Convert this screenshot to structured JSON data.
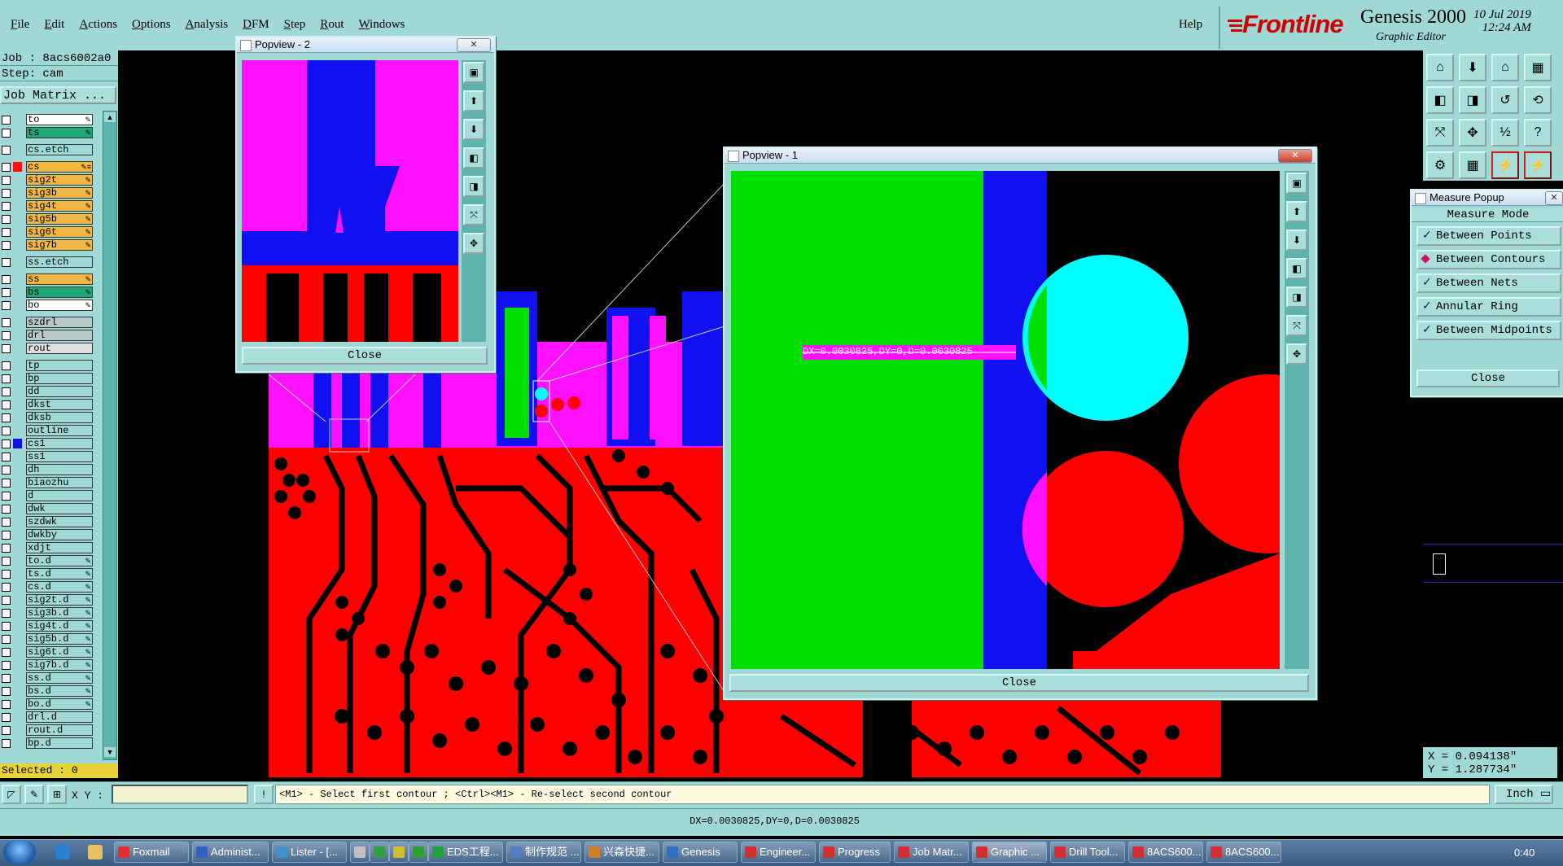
{
  "menu": {
    "items": [
      "File",
      "Edit",
      "Actions",
      "Options",
      "Analysis",
      "DFM",
      "Step",
      "Rout",
      "Windows"
    ],
    "help": "Help"
  },
  "brand": {
    "logo": "Frontline",
    "product": "Genesis 2000",
    "subtitle": "Graphic Editor",
    "date": "10 Jul 2019",
    "time": "12:24 AM"
  },
  "left_panel": {
    "job": "Job : 8acs6002a0",
    "step": "Step: cam",
    "job_matrix": "Job Matrix ...",
    "selected": "Selected : 0",
    "layers": [
      {
        "name": "to",
        "color": "#ffffff",
        "mark": "✎",
        "group": 1
      },
      {
        "name": "ts",
        "color": "#1fa876",
        "mark": "✎",
        "group": 1
      },
      {
        "name": "cs.etch",
        "color": "#9fd8d4",
        "mark": "",
        "group": 2
      },
      {
        "name": "cs",
        "color": "#f0b840",
        "mark": "✎≡",
        "group": 3,
        "swatch": "#ff1010"
      },
      {
        "name": "sig2t",
        "color": "#f0b840",
        "mark": "✎",
        "group": 3
      },
      {
        "name": "sig3b",
        "color": "#f0b840",
        "mark": "✎",
        "group": 3
      },
      {
        "name": "sig4t",
        "color": "#f0b840",
        "mark": "✎",
        "group": 3
      },
      {
        "name": "sig5b",
        "color": "#f0b840",
        "mark": "✎",
        "group": 3
      },
      {
        "name": "sig6t",
        "color": "#f0b840",
        "mark": "✎",
        "group": 3
      },
      {
        "name": "sig7b",
        "color": "#f0b840",
        "mark": "✎",
        "group": 3
      },
      {
        "name": "ss.etch",
        "color": "#9fd8d4",
        "mark": "",
        "group": 4
      },
      {
        "name": "ss",
        "color": "#f0b840",
        "mark": "✎",
        "group": 5
      },
      {
        "name": "bs",
        "color": "#1fa876",
        "mark": "✎",
        "group": 5
      },
      {
        "name": "bo",
        "color": "#ffffff",
        "mark": "✎",
        "group": 5
      },
      {
        "name": "szdrl",
        "color": "#b8c8c8",
        "mark": "",
        "group": 6
      },
      {
        "name": "drl",
        "color": "#b8c8c8",
        "mark": "",
        "group": 6
      },
      {
        "name": "rout",
        "color": "#e0e0e0",
        "mark": "",
        "group": 6
      },
      {
        "name": "tp",
        "color": "#9fd8d4",
        "mark": "",
        "group": 7
      },
      {
        "name": "bp",
        "color": "#9fd8d4",
        "mark": "",
        "group": 7
      },
      {
        "name": "dd",
        "color": "#9fd8d4",
        "mark": "",
        "group": 7
      },
      {
        "name": "dkst",
        "color": "#9fd8d4",
        "mark": "",
        "group": 7
      },
      {
        "name": "dksb",
        "color": "#9fd8d4",
        "mark": "",
        "group": 7
      },
      {
        "name": "outline",
        "color": "#9fd8d4",
        "mark": "",
        "group": 7
      },
      {
        "name": "cs1",
        "color": "#9fd8d4",
        "mark": "",
        "group": 7,
        "swatch": "#1010e0"
      },
      {
        "name": "ss1",
        "color": "#9fd8d4",
        "mark": "",
        "group": 7
      },
      {
        "name": "dh",
        "color": "#9fd8d4",
        "mark": "",
        "group": 7
      },
      {
        "name": "biaozhu",
        "color": "#9fd8d4",
        "mark": "",
        "group": 7
      },
      {
        "name": "d",
        "color": "#9fd8d4",
        "mark": "",
        "group": 7
      },
      {
        "name": "dwk",
        "color": "#9fd8d4",
        "mark": "",
        "group": 7
      },
      {
        "name": "szdwk",
        "color": "#9fd8d4",
        "mark": "",
        "group": 7
      },
      {
        "name": "dwkby",
        "color": "#9fd8d4",
        "mark": "",
        "group": 7
      },
      {
        "name": "xdjt",
        "color": "#9fd8d4",
        "mark": "",
        "group": 7
      },
      {
        "name": "to.d",
        "color": "#9fd8d4",
        "mark": "✎",
        "group": 7
      },
      {
        "name": "ts.d",
        "color": "#9fd8d4",
        "mark": "✎",
        "group": 7
      },
      {
        "name": "cs.d",
        "color": "#9fd8d4",
        "mark": "✎",
        "group": 7
      },
      {
        "name": "sig2t.d",
        "color": "#9fd8d4",
        "mark": "✎",
        "group": 7
      },
      {
        "name": "sig3b.d",
        "color": "#9fd8d4",
        "mark": "✎",
        "group": 7
      },
      {
        "name": "sig4t.d",
        "color": "#9fd8d4",
        "mark": "✎",
        "group": 7
      },
      {
        "name": "sig5b.d",
        "color": "#9fd8d4",
        "mark": "✎",
        "group": 7
      },
      {
        "name": "sig6t.d",
        "color": "#9fd8d4",
        "mark": "✎",
        "group": 7
      },
      {
        "name": "sig7b.d",
        "color": "#9fd8d4",
        "mark": "✎",
        "group": 7
      },
      {
        "name": "ss.d",
        "color": "#9fd8d4",
        "mark": "✎",
        "group": 7
      },
      {
        "name": "bs.d",
        "color": "#9fd8d4",
        "mark": "✎",
        "group": 7
      },
      {
        "name": "bo.d",
        "color": "#9fd8d4",
        "mark": "✎",
        "group": 7
      },
      {
        "name": "drl.d",
        "color": "#9fd8d4",
        "mark": "",
        "group": 7
      },
      {
        "name": "rout.d",
        "color": "#9fd8d4",
        "mark": "",
        "group": 7
      },
      {
        "name": "bp.d",
        "color": "#9fd8d4",
        "mark": "",
        "group": 7
      }
    ]
  },
  "popview2": {
    "title": "Popview - 2",
    "close": "Close"
  },
  "popview1": {
    "title": "Popview - 1",
    "close": "Close",
    "measure_label": "DX=0.0030825,DY=0,D=0.0030825"
  },
  "measure_popup": {
    "title": "Measure Popup",
    "mode_label": "Measure Mode",
    "modes": [
      "Between Points",
      "Between Contours",
      "Between Nets",
      "Annular Ring",
      "Between Midpoints"
    ],
    "selected_mode": "Between Contours",
    "close": "Close"
  },
  "coords": {
    "x": "X = 0.094138\"",
    "y": "Y = 1.287734\""
  },
  "command_bar": {
    "xy_label": "X Y :",
    "xy_value": "",
    "prompt": "<M1> - Select first contour ; <Ctrl><M1> - Re-select second contour",
    "unit": "Inch"
  },
  "status": "DX=0.0030825,DY=0,D=0.0030825",
  "colors": {
    "panel": "#9fd8d4",
    "layer_red": "#ff0000",
    "layer_blue": "#1010f0",
    "layer_magenta": "#ff10ff",
    "layer_green": "#00e000",
    "layer_cyan": "#00ffff"
  },
  "taskbar": {
    "tasks": [
      "Foxmail",
      "Administ...",
      "Lister - [...",
      "",
      "",
      "",
      "",
      "EDS工程...",
      "制作规范 ...",
      "兴森快捷...",
      "Genesis",
      "Engineer...",
      "Progress",
      "Job Matr...",
      "Graphic ...",
      "Drill Tool...",
      "8ACS600...",
      "8ACS600..."
    ],
    "clock": "0:40"
  }
}
